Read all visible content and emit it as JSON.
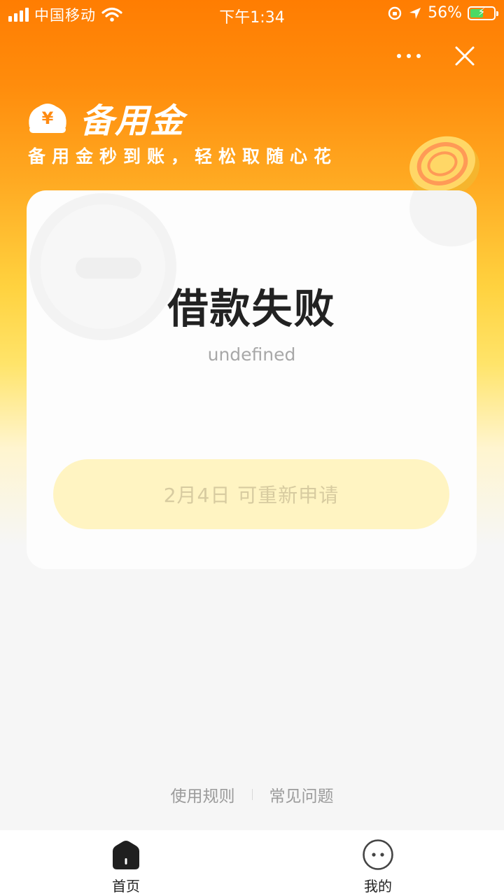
{
  "status_bar": {
    "carrier": "中国移动",
    "time": "下午1:34",
    "battery": "56%",
    "battery_level": 0.56
  },
  "header": {
    "more_icon": "more-dots-icon",
    "close_icon": "close-icon",
    "brand_name": "备用金",
    "brand_logo_symbol": "¥",
    "slogan": "备用金秒到账，轻松取随心花"
  },
  "card": {
    "title": "借款失败",
    "subtitle": "undefined",
    "button_label": "2月4日 可重新申请"
  },
  "links": {
    "rules": "使用规则",
    "faq": "常见问题"
  },
  "tabbar": {
    "home_label": "首页",
    "mine_label": "我的"
  },
  "colors": {
    "brand_orange": "#ff7d02",
    "brand_yellow": "#ffd23f",
    "button_bg": "#fff4c2",
    "button_text": "#d7cba0"
  }
}
